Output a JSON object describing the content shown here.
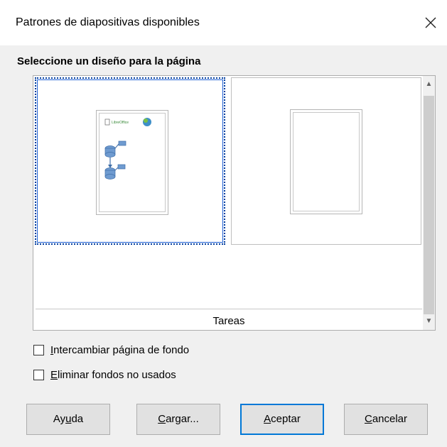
{
  "dialog": {
    "title": "Patrones de diapositivas disponibles",
    "section_label": "Seleccione un diseño para la página"
  },
  "designs": {
    "group_label": "Tareas",
    "items": [
      {
        "name": "",
        "selected": true,
        "preview": "flowchart-logo"
      },
      {
        "name": "",
        "selected": false,
        "preview": "blank"
      }
    ],
    "thumb_logo_text": "LibreOffice"
  },
  "options": {
    "swap_background": {
      "first": "I",
      "rest": "ntercambiar página de fondo",
      "checked": false
    },
    "delete_unused": {
      "first": "E",
      "rest": "liminar fondos no usados",
      "checked": false
    }
  },
  "buttons": {
    "help": {
      "pre": "Ay",
      "key": "u",
      "post": "da"
    },
    "load": {
      "pre": "",
      "key": "C",
      "post": "argar..."
    },
    "ok": {
      "pre": "",
      "key": "A",
      "post": "ceptar"
    },
    "cancel": {
      "pre": "",
      "key": "C",
      "post": "ancelar"
    }
  },
  "colors": {
    "accent": "#0078d7",
    "selection": "#003c9e",
    "shape_fill": "#6f9bd0"
  },
  "icons": {
    "close": "close-icon",
    "scroll_up": "chevron-up-icon",
    "scroll_down": "chevron-down-icon"
  }
}
